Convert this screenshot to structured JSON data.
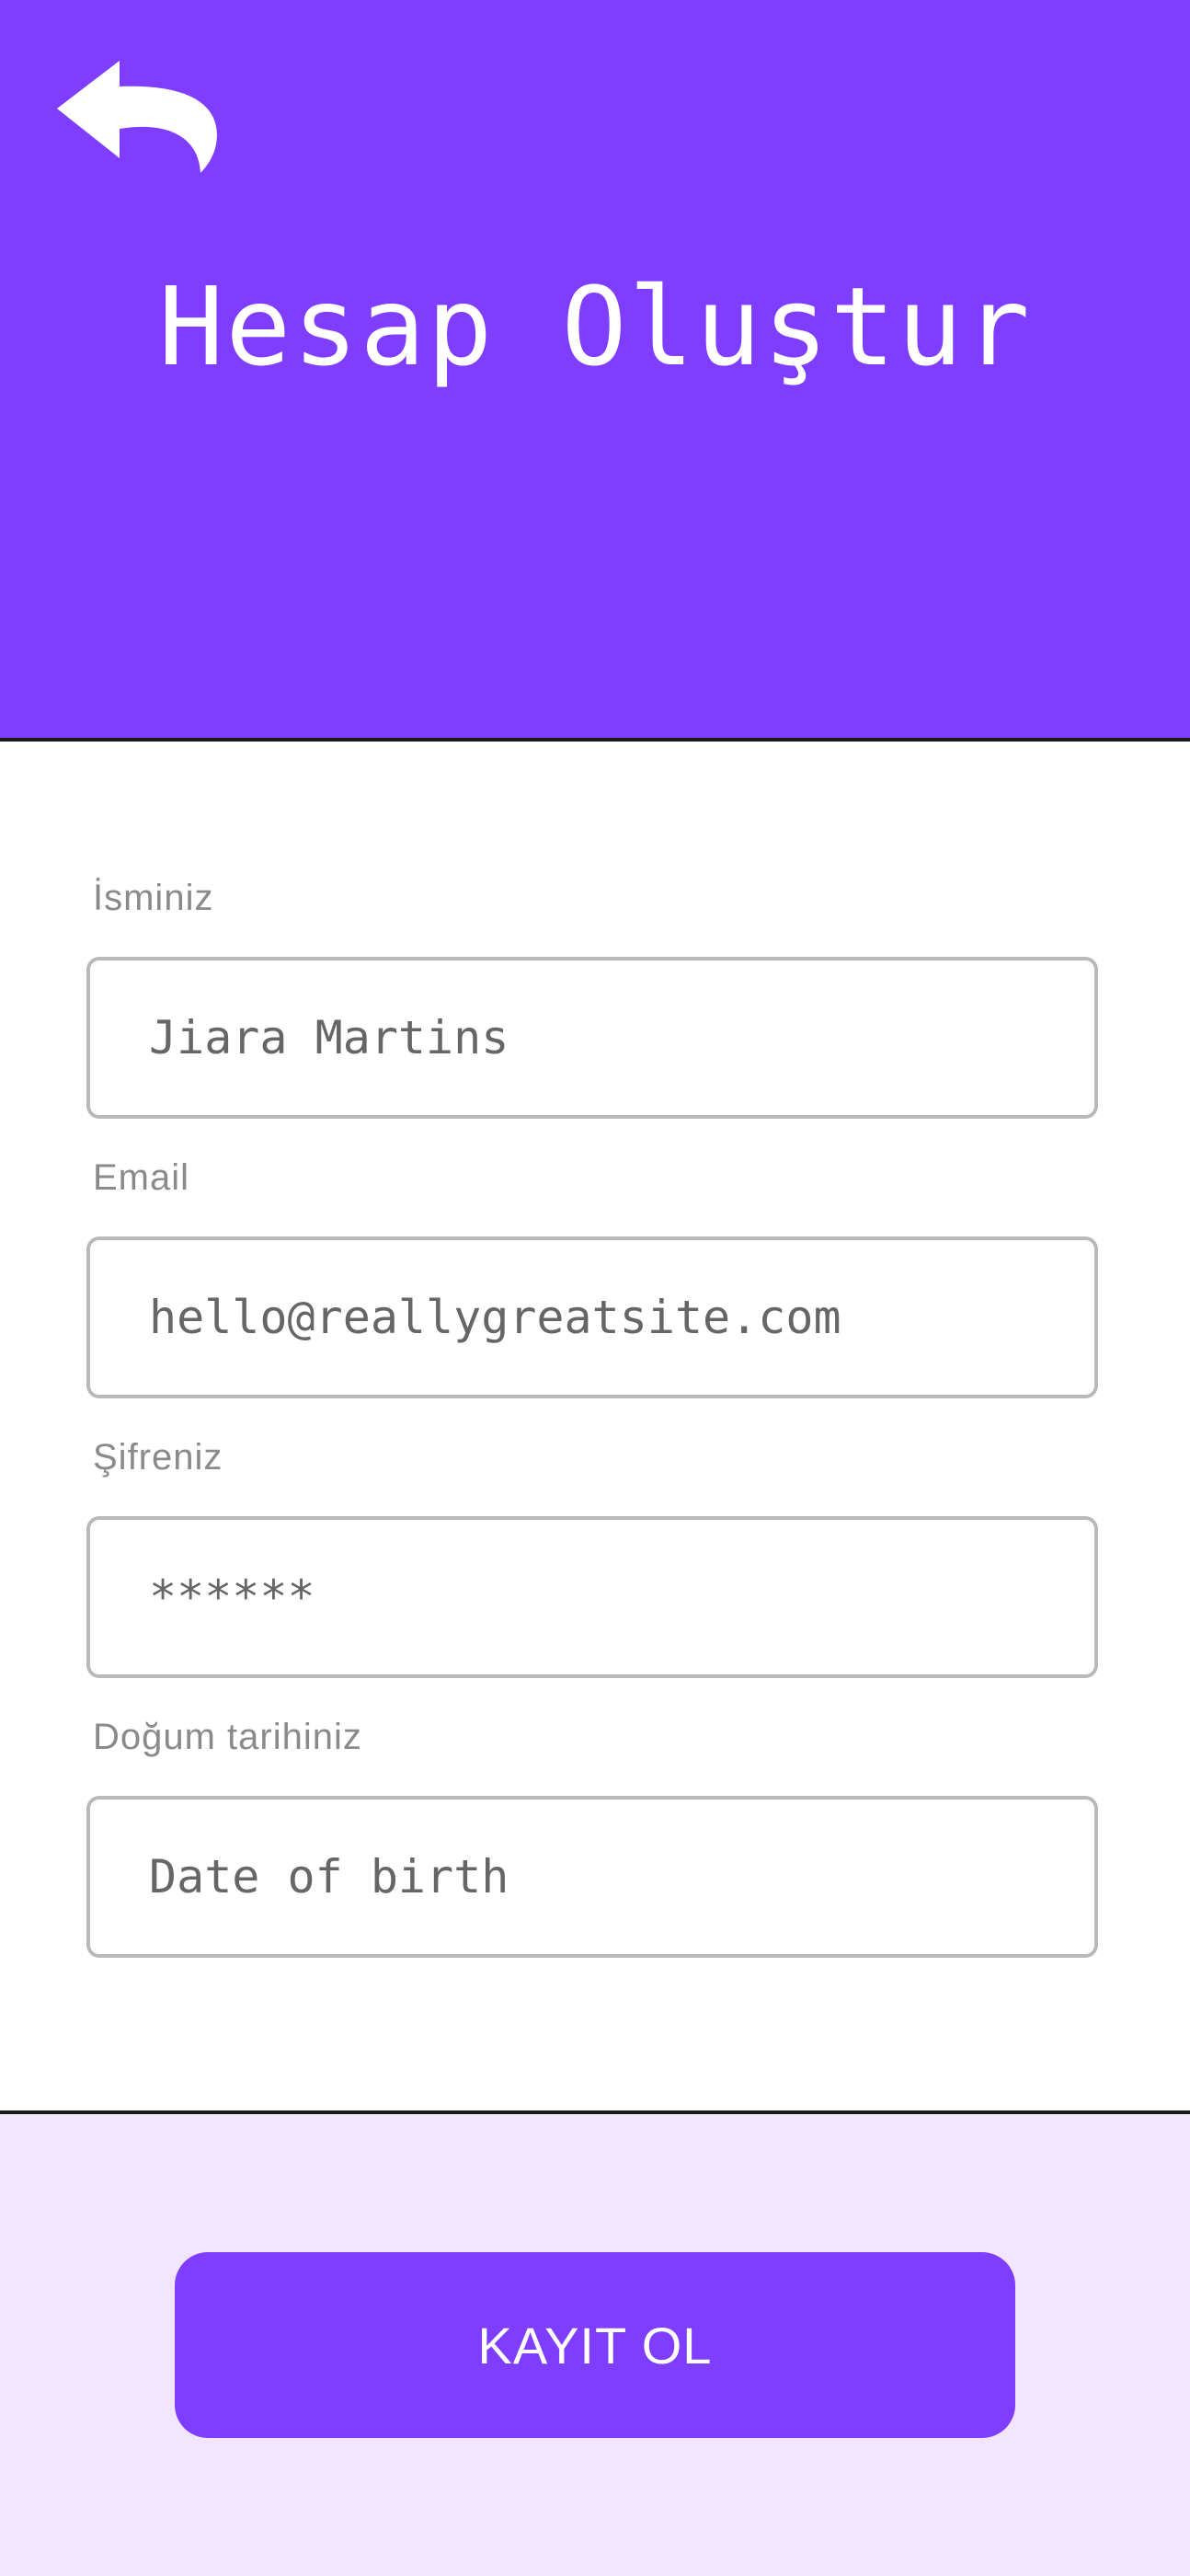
{
  "header": {
    "title": "Hesap Oluştur",
    "back_icon": "back-arrow-icon",
    "background_color": "#7f3dff"
  },
  "form": {
    "fields": [
      {
        "label": "İsminiz",
        "value": "Jiara Martins",
        "placeholder": ""
      },
      {
        "label": "Email",
        "value": "hello@reallygreatsite.com",
        "placeholder": ""
      },
      {
        "label": "Şifreniz",
        "value": "******",
        "placeholder": ""
      },
      {
        "label": "Doğum tarihiniz",
        "value": "",
        "placeholder": "Date of birth"
      }
    ]
  },
  "footer": {
    "submit_label": "KAYIT OL",
    "background_color": "#f2e5ff",
    "button_color": "#7f3dff"
  }
}
